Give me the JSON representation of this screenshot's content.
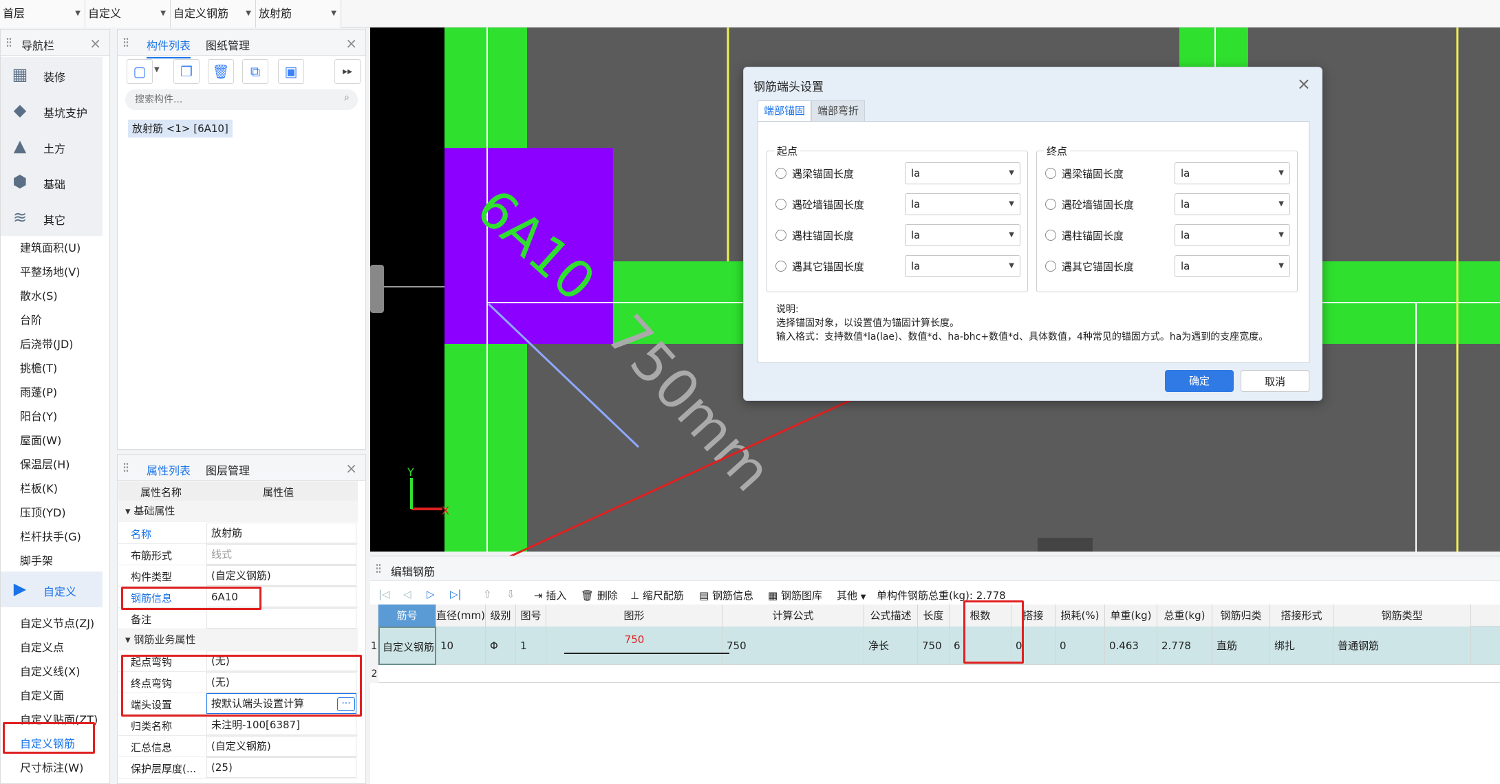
{
  "topbar": {
    "selects": [
      "首层",
      "自定义",
      "自定义钢筋",
      "放射筋"
    ]
  },
  "nav": {
    "title": "导航栏",
    "big_items": [
      {
        "label": "装修",
        "icon": "decoration-icon"
      },
      {
        "label": "基坑支护",
        "icon": "pit-support-icon"
      },
      {
        "label": "土方",
        "icon": "earthwork-icon"
      },
      {
        "label": "基础",
        "icon": "foundation-icon"
      },
      {
        "label": "其它",
        "icon": "other-icon"
      }
    ],
    "small_items_a": [
      "建筑面积(U)",
      "平整场地(V)",
      "散水(S)",
      "台阶",
      "后浇带(JD)",
      "挑檐(T)",
      "雨蓬(P)",
      "阳台(Y)",
      "屋面(W)",
      "保温层(H)",
      "栏板(K)",
      "压顶(YD)",
      "栏杆扶手(G)",
      "脚手架"
    ],
    "custom_label": "自定义",
    "small_items_b": [
      "自定义节点(ZJ)",
      "自定义点",
      "自定义线(X)",
      "自定义面",
      "自定义贴面(ZT)",
      "自定义钢筋",
      "尺寸标注(W)"
    ]
  },
  "component_panel": {
    "tabs": [
      "构件列表",
      "图纸管理"
    ],
    "search_placeholder": "搜索构件...",
    "item": "放射筋 <1> [6A10]"
  },
  "property_panel": {
    "tabs": [
      "属性列表",
      "图层管理"
    ],
    "col_name": "属性名称",
    "col_value": "属性值",
    "section1": "基础属性",
    "rows1": [
      {
        "name": "名称",
        "value": "放射筋"
      },
      {
        "name": "布筋形式",
        "value": "线式"
      },
      {
        "name": "构件类型",
        "value": "(自定义钢筋)"
      },
      {
        "name": "钢筋信息",
        "value": "6A10"
      },
      {
        "name": "备注",
        "value": ""
      }
    ],
    "section2": "钢筋业务属性",
    "rows2": [
      {
        "name": "起点弯钩",
        "value": "(无)"
      },
      {
        "name": "终点弯钩",
        "value": "(无)"
      },
      {
        "name": "端头设置",
        "value": "按默认端头设置计算"
      },
      {
        "name": "归类名称",
        "value": "未注明-100[6387]"
      },
      {
        "name": "汇总信息",
        "value": "(自定义钢筋)"
      },
      {
        "name": "保护层厚度(...",
        "value": "(25)"
      }
    ]
  },
  "canvas": {
    "rebar_label": "6A10",
    "dim_label": "750mm",
    "axis_x": "X",
    "axis_y": "Y"
  },
  "dialog": {
    "title": "钢筋端头设置",
    "tabs": [
      "端部锚固",
      "端部弯折"
    ],
    "start_group": "起点",
    "end_group": "终点",
    "options": [
      "遇梁锚固长度",
      "遇砼墙锚固长度",
      "遇柱锚固长度",
      "遇其它锚固长度"
    ],
    "select_value": "la",
    "note_title": "说明:",
    "note_line1": "选择锚固对象，以设置值为锚固计算长度。",
    "note_line2": "输入格式：支持数值*la(lae)、数值*d、ha-bhc+数值*d、具体数值，4种常见的锚固方式。ha为遇到的支座宽度。",
    "ok": "确定",
    "cancel": "取消"
  },
  "edit_panel": {
    "title": "编辑钢筋",
    "tools": [
      "插入",
      "删除",
      "缩尺配筋",
      "钢筋信息",
      "钢筋图库",
      "其他"
    ],
    "total_weight_label": "单构件钢筋总重(kg): 2.778",
    "headers": [
      "筋号",
      "直径(mm)",
      "级别",
      "图号",
      "图形",
      "计算公式",
      "公式描述",
      "长度",
      "根数",
      "搭接",
      "损耗(%)",
      "单重(kg)",
      "总重(kg)",
      "钢筋归类",
      "搭接形式",
      "钢筋类型"
    ],
    "row1": {
      "index": "1",
      "cells": [
        "自定义钢筋",
        "10",
        "Φ",
        "1",
        "750",
        "750",
        "净长",
        "750",
        "6",
        "0",
        "0",
        "0.463",
        "2.778",
        "直筋",
        "绑扎",
        "普通钢筋"
      ]
    },
    "row2_index": "2"
  },
  "colors": {
    "accent": "#1a73e8",
    "annotation_red": "#e02020",
    "green": "#2fe02f",
    "purple": "#8c00ff",
    "canvas_bg": "#5b5b5b"
  }
}
